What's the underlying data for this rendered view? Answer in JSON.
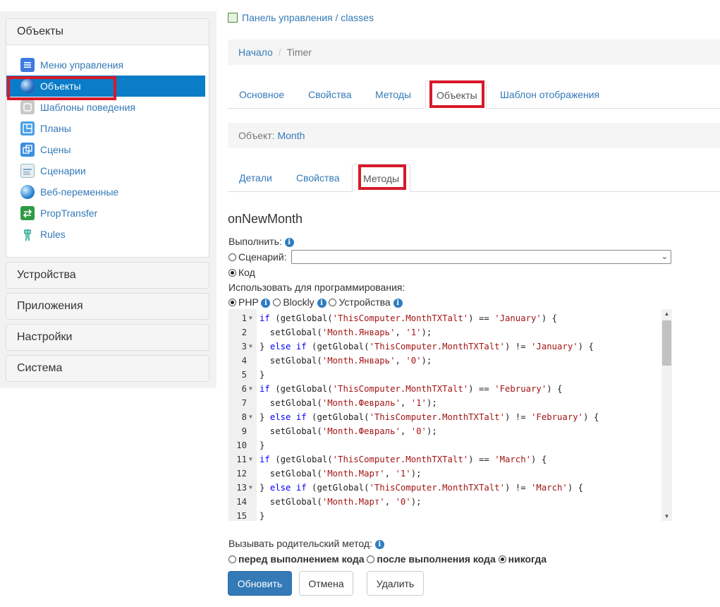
{
  "sidebar": {
    "sections": [
      {
        "title": "Объекты"
      },
      {
        "title": "Устройства"
      },
      {
        "title": "Приложения"
      },
      {
        "title": "Настройки"
      },
      {
        "title": "Система"
      }
    ],
    "items": [
      {
        "label": "Меню управления",
        "icon": "menu-icon"
      },
      {
        "label": "Объекты",
        "icon": "globe-icon"
      },
      {
        "label": "Шаблоны поведения",
        "icon": "template-icon"
      },
      {
        "label": "Планы",
        "icon": "plan-icon"
      },
      {
        "label": "Сцены",
        "icon": "scenes-icon"
      },
      {
        "label": "Сценарии",
        "icon": "script-icon"
      },
      {
        "label": "Веб-переменные",
        "icon": "web-globe-icon"
      },
      {
        "label": "PropTransfer",
        "icon": "transfer-icon"
      },
      {
        "label": "Rules",
        "icon": "robot-icon"
      }
    ]
  },
  "header": {
    "path": "Панель управления / classes",
    "breadcrumb_home": "Начало",
    "breadcrumb_sep": "/",
    "breadcrumb_current": "Timer"
  },
  "tabs_main": [
    "Основное",
    "Свойства",
    "Методы",
    "Объекты",
    "Шаблон отображения"
  ],
  "object_bar": {
    "label": "Объект:",
    "value": "Month"
  },
  "tabs_object": [
    "Детали",
    "Свойства",
    "Методы"
  ],
  "method": {
    "title": "onNewMonth",
    "execute_label": "Выполнить:",
    "opt_scenario": "Сценарий:",
    "opt_code": "Код",
    "use_for_label": "Использовать для программирования:",
    "lang_php": "PHP",
    "lang_blockly": "Blockly",
    "lang_devices": "Устройства"
  },
  "code_lines": [
    {
      "n": "1",
      "fold": true,
      "tokens": [
        [
          "kw",
          "if"
        ],
        [
          "p",
          " (getGlobal("
        ],
        [
          "str",
          "'ThisComputer.MonthTXTalt'"
        ],
        [
          "p",
          ") == "
        ],
        [
          "str",
          "'January'"
        ],
        [
          "p",
          ") {"
        ]
      ]
    },
    {
      "n": "2",
      "fold": false,
      "tokens": [
        [
          "p",
          "  setGlobal("
        ],
        [
          "str",
          "'Month.Январь'"
        ],
        [
          "p",
          ", "
        ],
        [
          "str",
          "'1'"
        ],
        [
          "p",
          ");"
        ]
      ]
    },
    {
      "n": "3",
      "fold": true,
      "tokens": [
        [
          "p",
          "} "
        ],
        [
          "kw",
          "else if"
        ],
        [
          "p",
          " (getGlobal("
        ],
        [
          "str",
          "'ThisComputer.MonthTXTalt'"
        ],
        [
          "p",
          ") != "
        ],
        [
          "str",
          "'January'"
        ],
        [
          "p",
          ") {"
        ]
      ]
    },
    {
      "n": "4",
      "fold": false,
      "tokens": [
        [
          "p",
          "  setGlobal("
        ],
        [
          "str",
          "'Month.Январь'"
        ],
        [
          "p",
          ", "
        ],
        [
          "str",
          "'0'"
        ],
        [
          "p",
          ");"
        ]
      ]
    },
    {
      "n": "5",
      "fold": false,
      "tokens": [
        [
          "p",
          "}"
        ]
      ]
    },
    {
      "n": "6",
      "fold": true,
      "tokens": [
        [
          "kw",
          "if"
        ],
        [
          "p",
          " (getGlobal("
        ],
        [
          "str",
          "'ThisComputer.MonthTXTalt'"
        ],
        [
          "p",
          ") == "
        ],
        [
          "str",
          "'February'"
        ],
        [
          "p",
          ") {"
        ]
      ]
    },
    {
      "n": "7",
      "fold": false,
      "tokens": [
        [
          "p",
          "  setGlobal("
        ],
        [
          "str",
          "'Month.Февраль'"
        ],
        [
          "p",
          ", "
        ],
        [
          "str",
          "'1'"
        ],
        [
          "p",
          ");"
        ]
      ]
    },
    {
      "n": "8",
      "fold": true,
      "tokens": [
        [
          "p",
          "} "
        ],
        [
          "kw",
          "else if"
        ],
        [
          "p",
          " (getGlobal("
        ],
        [
          "str",
          "'ThisComputer.MonthTXTalt'"
        ],
        [
          "p",
          ") != "
        ],
        [
          "str",
          "'February'"
        ],
        [
          "p",
          ") {"
        ]
      ]
    },
    {
      "n": "9",
      "fold": false,
      "tokens": [
        [
          "p",
          "  setGlobal("
        ],
        [
          "str",
          "'Month.Февраль'"
        ],
        [
          "p",
          ", "
        ],
        [
          "str",
          "'0'"
        ],
        [
          "p",
          ");"
        ]
      ]
    },
    {
      "n": "10",
      "fold": false,
      "tokens": [
        [
          "p",
          "}"
        ]
      ]
    },
    {
      "n": "11",
      "fold": true,
      "tokens": [
        [
          "kw",
          "if"
        ],
        [
          "p",
          " (getGlobal("
        ],
        [
          "str",
          "'ThisComputer.MonthTXTalt'"
        ],
        [
          "p",
          ") == "
        ],
        [
          "str",
          "'March'"
        ],
        [
          "p",
          ") {"
        ]
      ]
    },
    {
      "n": "12",
      "fold": false,
      "tokens": [
        [
          "p",
          "  setGlobal("
        ],
        [
          "str",
          "'Month.Март'"
        ],
        [
          "p",
          ", "
        ],
        [
          "str",
          "'1'"
        ],
        [
          "p",
          ");"
        ]
      ]
    },
    {
      "n": "13",
      "fold": true,
      "tokens": [
        [
          "p",
          "} "
        ],
        [
          "kw",
          "else if"
        ],
        [
          "p",
          " (getGlobal("
        ],
        [
          "str",
          "'ThisComputer.MonthTXTalt'"
        ],
        [
          "p",
          ") != "
        ],
        [
          "str",
          "'March'"
        ],
        [
          "p",
          ") {"
        ]
      ]
    },
    {
      "n": "14",
      "fold": false,
      "tokens": [
        [
          "p",
          "  setGlobal("
        ],
        [
          "str",
          "'Month.Март'"
        ],
        [
          "p",
          ", "
        ],
        [
          "str",
          "'0'"
        ],
        [
          "p",
          ");"
        ]
      ]
    },
    {
      "n": "15",
      "fold": false,
      "tokens": [
        [
          "p",
          "}"
        ]
      ]
    }
  ],
  "parent_call": {
    "label": "Вызывать родительский метод:",
    "opt_before": "перед выполнением кода",
    "opt_after": "после выполнения кода",
    "opt_never": "никогда"
  },
  "buttons": {
    "update": "Обновить",
    "cancel": "Отмена",
    "delete": "Удалить"
  },
  "colors": {
    "accent": "#337ab7",
    "active_item": "#0b7cc7",
    "highlight_box": "#d71a2a"
  }
}
